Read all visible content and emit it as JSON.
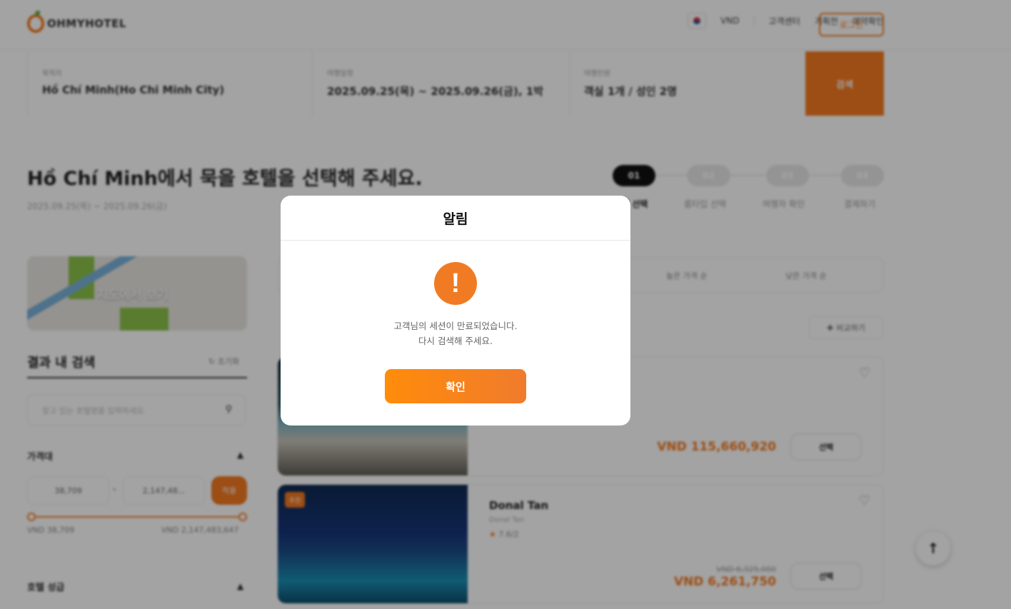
{
  "header": {
    "logo_text": "OHMYHOTEL",
    "currency": "VND",
    "nav": [
      "고객센터",
      "기획전",
      "예약확인"
    ],
    "login_label": "로그인"
  },
  "search": {
    "destination_label": "목적지",
    "destination_value": "Hồ Chí Minh(Ho Chi Minh City)",
    "dates_label": "여행일정",
    "dates_value": "2025.09.25(목) ~ 2025.09.26(금), 1박",
    "guests_label": "여행인원",
    "guests_value": "객실 1개 / 성인 2명",
    "button_label": "검색"
  },
  "main": {
    "title": "Hồ Chí Minh에서 묵을 호텔을 선택해 주세요.",
    "dates": "2025.09.25(목) ~ 2025.09.26(금)",
    "steps": [
      {
        "num": "01",
        "label": "호텔 선택"
      },
      {
        "num": "02",
        "label": "룸타입 선택"
      },
      {
        "num": "03",
        "label": "여행자 확인"
      },
      {
        "num": "04",
        "label": "결제하기"
      }
    ]
  },
  "sidebar": {
    "map_label": "지도에서 보기",
    "filter_title": "결과 내 검색",
    "reset_label": "초기화",
    "search_placeholder": "찾고 있는 호텔명을 입력하세요.",
    "price_title": "가격대",
    "price_min": "38,709",
    "price_max": "2,147,48...",
    "range_sep": "-",
    "apply_label": "적용",
    "range_min_label": "VND 38,709",
    "range_max_label": "VND 2,147,483,647",
    "grade_title": "호텔 성급"
  },
  "results": {
    "sort_options": [
      "높은 가격 순",
      "낮은 가격 순"
    ],
    "compare_label": "비교하기",
    "cards": [
      {
        "price": "VND 115,660,920",
        "select_label": "선택"
      },
      {
        "badge": "추천",
        "name": "Donal Tan",
        "sub": "Donal Tan",
        "rating": "7.6/2",
        "old_price": "VND 6,325,000",
        "price": "VND 6,261,750",
        "select_label": "선택"
      }
    ]
  },
  "modal": {
    "title": "알림",
    "icon": "!",
    "message_line1": "고객님의 세션이 만료되었습니다.",
    "message_line2": "다시 검색해 주세요.",
    "confirm_label": "확인"
  },
  "colors": {
    "accent": "#f47a20",
    "alert_icon": "#f07b22"
  }
}
